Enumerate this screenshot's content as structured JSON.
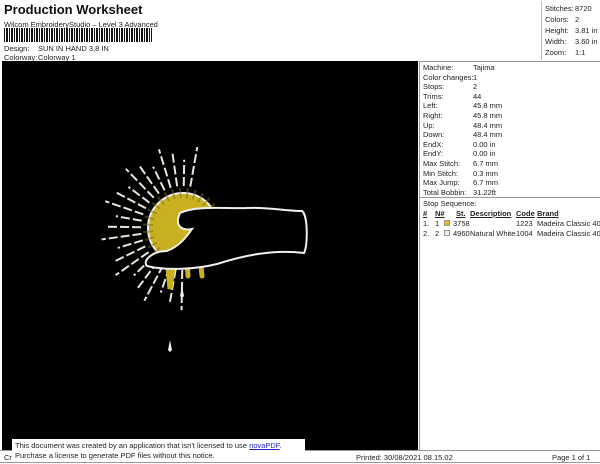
{
  "header": {
    "title": "Production Worksheet",
    "subtitle": "Wilcom EmbroideryStudio – Level 3 Advanced",
    "design_label": "Design:",
    "design_value": "SUN IN HAND 3,8 IN",
    "colorway_label": "Colorway:",
    "colorway_value": "Colorway 1"
  },
  "stats": [
    {
      "label": "Stitches:",
      "value": "8720"
    },
    {
      "label": "Colors:",
      "value": "2"
    },
    {
      "label": "Height:",
      "value": "3.81 in"
    },
    {
      "label": "Width:",
      "value": "3.60 in"
    },
    {
      "label": "Zoom:",
      "value": "1:1"
    }
  ],
  "details": [
    {
      "label": "Machine:",
      "value": "Tajima"
    },
    {
      "label": "Color changes:",
      "value": "1"
    },
    {
      "label": "Stops:",
      "value": "2"
    },
    {
      "label": "Trims:",
      "value": "44"
    },
    {
      "label": "Left:",
      "value": "45.8 mm"
    },
    {
      "label": "Right:",
      "value": "45.8 mm"
    },
    {
      "label": "Up:",
      "value": "48.4 mm"
    },
    {
      "label": "Down:",
      "value": "48.4 mm"
    },
    {
      "label": "EndX:",
      "value": "0.00 in"
    },
    {
      "label": "EndY:",
      "value": "0.00 in"
    },
    {
      "label": "Max Stitch:",
      "value": "6.7 mm"
    },
    {
      "label": "Min Stitch:",
      "value": "0.3 mm"
    },
    {
      "label": "Max Jump:",
      "value": "6.7 mm"
    },
    {
      "label": "Total Bobbin:",
      "value": "31.22ft"
    }
  ],
  "stop_sequence": {
    "title": "Stop Sequence:",
    "headers": [
      "#",
      "N#",
      "St.",
      "Description",
      "Code",
      "Brand"
    ],
    "rows": [
      {
        "idx": "1.",
        "n": "1",
        "color": "#e8b820",
        "st": "3758",
        "desc": "",
        "code": "1223",
        "brand": "Madeira Classic 40"
      },
      {
        "idx": "2.",
        "n": "2",
        "color": "#ececec",
        "st": "4960",
        "desc": "Natural White",
        "code": "1004",
        "brand": "Madeira Classic 40"
      }
    ]
  },
  "footer": {
    "left": "Cr",
    "printed": "Printed: 30/08/2021 08.15.02",
    "page": "Page 1 of 1"
  },
  "notice": {
    "line1": "This document was created by an application that isn't licensed to use ",
    "link": "novaPDF",
    "line1_end": ".",
    "line2": "Purchase a license to generate PDF files without this notice."
  }
}
